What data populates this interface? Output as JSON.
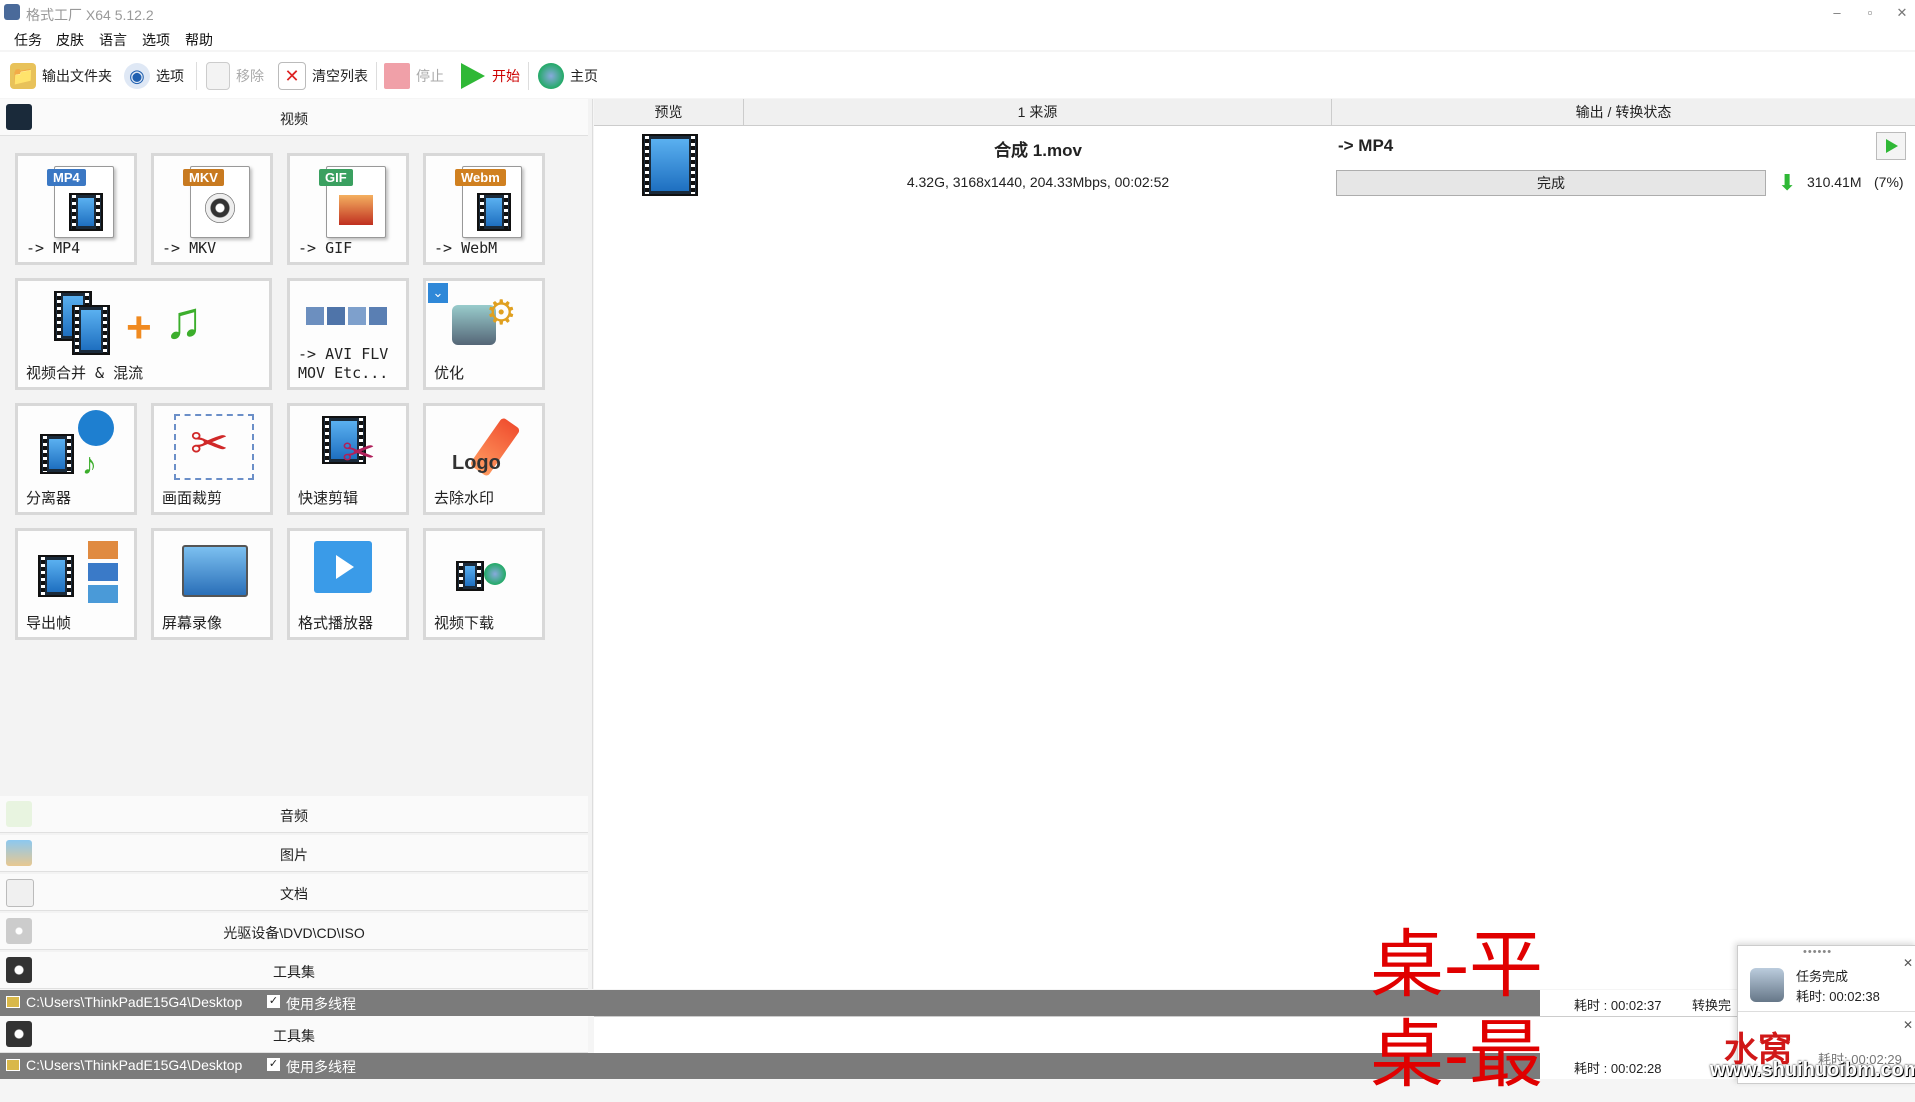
{
  "window": {
    "title": "格式工厂 X64 5.12.2",
    "min": "–",
    "restore": "▫",
    "close": "✕"
  },
  "menu": [
    "任务",
    "皮肤",
    "语言",
    "选项",
    "帮助"
  ],
  "toolbar": {
    "output_folder": "输出文件夹",
    "options": "选项",
    "remove": "移除",
    "clear_list": "清空列表",
    "stop": "停止",
    "start": "开始",
    "home": "主页"
  },
  "left": {
    "video_header": "视频",
    "tiles": {
      "mp4_badge": "MP4",
      "mp4": "-> MP4",
      "mkv_badge": "MKV",
      "mkv": "-> MKV",
      "gif_badge": "GIF",
      "gif": "-> GIF",
      "webm_badge": "Webm",
      "webm": "-> WebM",
      "merge": "视频合并 & 混流",
      "others": "-> AVI FLV\nMOV Etc...",
      "optimize": "优化",
      "splitter": "分离器",
      "crop": "画面裁剪",
      "quick_cut": "快速剪辑",
      "logo_text": "Logo",
      "remove_watermark": "去除水印",
      "export_frames": "导出帧",
      "screen_record": "屏幕录像",
      "player": "格式播放器",
      "download": "视频下载"
    },
    "categories": {
      "audio": "音频",
      "image": "图片",
      "document": "文档",
      "disc": "光驱设备\\DVD\\CD\\ISO",
      "tools": "工具集"
    }
  },
  "table": {
    "headers": {
      "preview": "预览",
      "source": "1 来源",
      "output": "输出 / 转换状态"
    },
    "row": {
      "filename": "合成 1.mov",
      "info": "4.32G, 3168x1440, 204.33Mbps, 00:02:52",
      "target": "-> MP4",
      "status": "完成",
      "size": "310.41M",
      "ratio": "(7%)"
    }
  },
  "status": {
    "path": "C:\\Users\\ThinkPadE15G4\\Desktop",
    "multithread": "使用多线程",
    "elapsed1": "耗时 : 00:02:37",
    "convert_done": "转换完",
    "elapsed2": "耗时 : 00:02:28",
    "tools_repeat": "工具集"
  },
  "notification": {
    "dots": "••••••",
    "title": "任务完成",
    "elapsed": "耗时: 00:02:38",
    "elapsed_under": "耗时: 00:02:29",
    "close": "✕"
  },
  "watermarks": {
    "line1": "桌-平",
    "line2": "桌-最",
    "brand": "水窝",
    "url": "www.shuihuoibm.com"
  },
  "colors": {
    "accent_green": "#2fb836",
    "status_bar": "#7b7b7b",
    "watermark_red": "#e00000"
  },
  "icons": [
    "folder-icon",
    "options-icon",
    "remove-icon",
    "clear-icon",
    "stop-icon",
    "play-icon",
    "home-globe-icon"
  ]
}
